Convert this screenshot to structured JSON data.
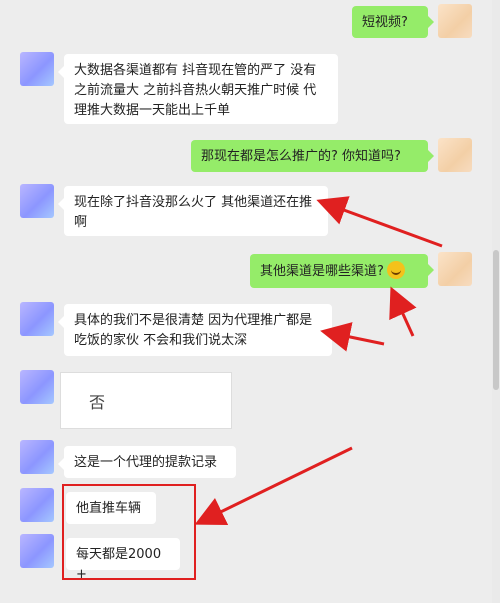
{
  "messages": [
    {
      "side": "out",
      "text": "短视频?"
    },
    {
      "side": "in",
      "text": "大数据各渠道都有  抖音现在管的严了  没有之前流量大    之前抖音热火朝天推广时候 代理推大数据一天能出上千单"
    },
    {
      "side": "out",
      "text": "那现在都是怎么推广的? 你知道吗?"
    },
    {
      "side": "in",
      "text": "现在除了抖音没那么火了 其他渠道还在推啊"
    },
    {
      "side": "out",
      "text": "其他渠道是哪些渠道?"
    },
    {
      "side": "in",
      "text": "具体的我们不是很清楚 因为代理推广都是吃饭的家伙    不会和我们说太深"
    },
    {
      "side": "in",
      "text": "否"
    },
    {
      "side": "in",
      "text": "这是一个代理的提款记录"
    },
    {
      "side": "in",
      "text": "他直推车辆"
    },
    {
      "side": "in",
      "text": "每天都是2000+"
    }
  ],
  "icons": {
    "emoji": "grinning-sweat-emoji-icon",
    "annotation": "red-arrow-icon"
  },
  "colors": {
    "background": "#ededed",
    "outgoing": "#95ec69",
    "incoming": "#ffffff",
    "annotation": "#e02020"
  }
}
